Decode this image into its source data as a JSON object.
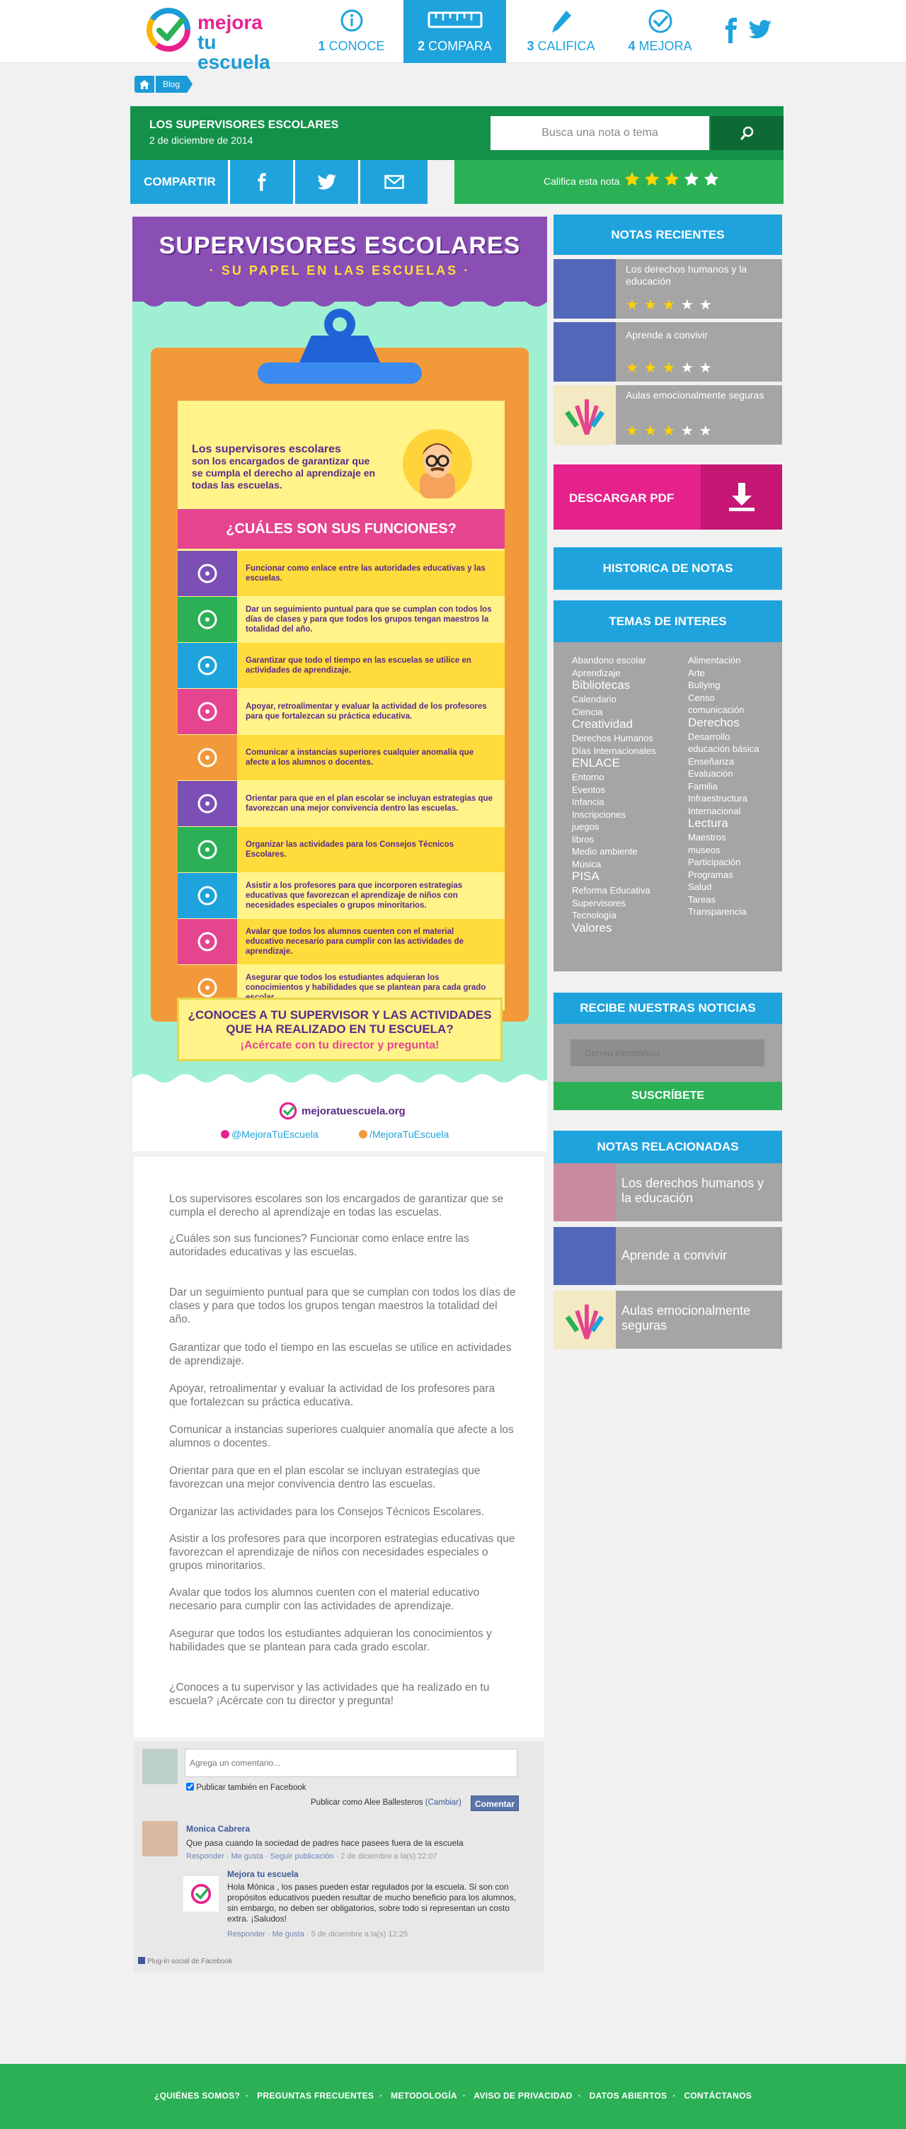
{
  "brand": {
    "line1": "mejora",
    "line2": "tu escuela"
  },
  "nav": [
    {
      "num": "1",
      "label": "CONOCE",
      "icon": "info-icon"
    },
    {
      "num": "2",
      "label": "COMPARA",
      "icon": "ruler-icon"
    },
    {
      "num": "3",
      "label": "CALIFICA",
      "icon": "pencil-icon"
    },
    {
      "num": "4",
      "label": "MEJORA",
      "icon": "check-icon"
    }
  ],
  "breadcrumb": {
    "item": "Blog"
  },
  "post": {
    "title": "LOS SUPERVISORES ESCOLARES",
    "date": "2 de diciembre de 2014"
  },
  "search": {
    "placeholder": "Busca una nota o tema"
  },
  "share": {
    "label": "COMPARTIR",
    "rate_label": "Califica esta nota"
  },
  "infographic": {
    "title": "SUPERVISORES ESCOLARES",
    "subtitle": "· SU PAPEL EN LAS ESCUELAS ·",
    "intro_head": "Los supervisores escolares",
    "intro_body": "son los encargados de garantizar que se cumpla el derecho al aprendizaje en todas las escuelas.",
    "question": "¿CUÁLES SON SUS FUNCIONES?",
    "functions": [
      "Funcionar como enlace entre las autoridades educativas y las escuelas.",
      "Dar un seguimiento puntual para que se cumplan con todos los días de clases y para que todos los grupos tengan maestros la totalidad del año.",
      "Garantizar que todo el tiempo en las escuelas se utilice en actividades de aprendizaje.",
      "Apoyar, retroalimentar y evaluar la actividad de los profesores para que fortalezcan su práctica educativa.",
      "Comunicar a instancias superiores cualquier anomalía que afecte a los alumnos o docentes.",
      "Orientar para que en el plan escolar se incluyan estrategias que favorezcan una mejor convivencia dentro las escuelas.",
      "Organizar las actividades para los Consejos Técnicos Escolares.",
      "Asistir a los profesores para que incorporen estrategias educativas que favorezcan el aprendizaje de niños con necesidades especiales o grupos minoritarios.",
      "Avalar que todos los alumnos cuenten con el material educativo necesario para cumplir con las actividades de aprendizaje.",
      "Asegurar que todos los estudiantes adquieran los conocimientos y habilidades que se plantean para cada grado escolar."
    ],
    "cta_line1": "¿CONOCES A TU SUPERVISOR Y LAS ACTIVIDADES",
    "cta_line2": "QUE HA REALIZADO EN TU ESCUELA?",
    "cta_line3": "¡Acércate con tu director y pregunta!",
    "site": "mejoratuescuela.org",
    "twitter": "@MejoraTuEscuela",
    "facebook": "/MejoraTuEscuela"
  },
  "article": [
    "Los supervisores escolares son los encargados de garantizar que se cumpla el derecho al aprendizaje en todas las escuelas.",
    "¿Cuáles son sus funciones? Funcionar como enlace entre las autoridades educativas y las escuelas.",
    "Dar un seguimiento puntual para que se cumplan con todos los días de clases y para que todos los grupos tengan maestros la totalidad del año.",
    "Garantizar que todo el tiempo en las escuelas se utilice en actividades de aprendizaje.",
    "Apoyar, retroalimentar y evaluar la actividad de los profesores para que fortalezcan su práctica educativa.",
    "Comunicar a instancias superiores cualquier anomalía que afecte a los alumnos o docentes.",
    "Orientar para que en el plan escolar se incluyan estrategias que favorezcan una mejor convivencia dentro las escuelas.",
    "Organizar las actividades para los Consejos Técnicos Escolares.",
    "Asistir a los profesores para que incorporen estrategias educativas que favorezcan el aprendizaje de niños con necesidades especiales o grupos minoritarios.",
    "Avalar que todos los alumnos cuenten con el material educativo necesario para cumplir con las actividades de aprendizaje.",
    "Asegurar que todos los estudiantes adquieran los conocimientos y habilidades que se plantean para cada grado escolar.",
    "¿Conoces a tu supervisor y las actividades que ha realizado en tu escuela? ¡Acércate con tu director y pregunta!"
  ],
  "comments": {
    "placeholder": "Agrega un comentario...",
    "also_post": "Publicar también en Facebook",
    "post_as": "Publicar como Alee Ballesteros",
    "change": "(Cambiar)",
    "submit": "Comentar",
    "items": [
      {
        "name": "Monica Cabrera",
        "text": "Que pasa cuando la sociedad de padres hace pasees fuera de la escuela",
        "actions": "Responder · Me gusta · Seguir publicación",
        "date": "· 2 de diciembre a la(s) 22:07"
      },
      {
        "name": "Mejora tu escuela",
        "text": "Hola Mónica , los pases pueden estar regulados por la escuela. Si son con propósitos educativos pueden resultar de mucho beneficio para los alumnos, sin embargo, no deben ser obligatorios, sobre todo si representan un costo extra. ¡Saludos!",
        "actions": "Responder · Me gusta",
        "date": "· 5 de diciembre a la(s) 12:25"
      }
    ],
    "plugin": "Plug-in social de Facebook"
  },
  "sidebar": {
    "recent_title": "NOTAS RECIENTES",
    "recent": [
      {
        "title": "Los derechos humanos y la educación",
        "rating": 3
      },
      {
        "title": "Aprende  a convivir",
        "rating": 3
      },
      {
        "title": "Aulas emocionalmente seguras",
        "rating": 3
      }
    ],
    "pdf_label": "DESCARGAR PDF",
    "history_label": "HISTORICA DE NOTAS",
    "topics_title": "TEMAS DE INTERES",
    "topics_left": [
      {
        "t": "Abandono escolar",
        "s": 13
      },
      {
        "t": "Aprendizaje",
        "s": 13
      },
      {
        "t": "Bibliotecas",
        "s": 17
      },
      {
        "t": "Calendario",
        "s": 13
      },
      {
        "t": "Ciencia",
        "s": 13
      },
      {
        "t": "Creatividad",
        "s": 17
      },
      {
        "t": "Derechos Humanos",
        "s": 13
      },
      {
        "t": "Días Internacionales",
        "s": 13
      },
      {
        "t": "ENLACE",
        "s": 17
      },
      {
        "t": "Entorno",
        "s": 13
      },
      {
        "t": "Eventos",
        "s": 13
      },
      {
        "t": "Infancia",
        "s": 13
      },
      {
        "t": "Inscripciones",
        "s": 13
      },
      {
        "t": "juegos",
        "s": 13
      },
      {
        "t": "libros",
        "s": 13
      },
      {
        "t": "Medio ambiente",
        "s": 13
      },
      {
        "t": "Música",
        "s": 13
      },
      {
        "t": "PISA",
        "s": 17
      },
      {
        "t": "Reforma Educativa",
        "s": 13
      },
      {
        "t": "Supervisores",
        "s": 13
      },
      {
        "t": "Tecnología",
        "s": 13
      },
      {
        "t": "Valores",
        "s": 17
      }
    ],
    "topics_right": [
      {
        "t": "Alimentación",
        "s": 13
      },
      {
        "t": "Arte",
        "s": 13
      },
      {
        "t": "Bullying",
        "s": 13
      },
      {
        "t": "Censo",
        "s": 13
      },
      {
        "t": "comunicación",
        "s": 13
      },
      {
        "t": "Derechos",
        "s": 17
      },
      {
        "t": "Desarrollo",
        "s": 13
      },
      {
        "t": "educación básica",
        "s": 13
      },
      {
        "t": "Enseñanza",
        "s": 13
      },
      {
        "t": "Evaluación",
        "s": 13
      },
      {
        "t": "Familia",
        "s": 13
      },
      {
        "t": "Infraestructura",
        "s": 13
      },
      {
        "t": "Internacional",
        "s": 13
      },
      {
        "t": "Lectura",
        "s": 17
      },
      {
        "t": "Maestros",
        "s": 13
      },
      {
        "t": "museos",
        "s": 13
      },
      {
        "t": "Participación",
        "s": 13
      },
      {
        "t": "Programas",
        "s": 13
      },
      {
        "t": "Salud",
        "s": 13
      },
      {
        "t": "Tareas",
        "s": 13
      },
      {
        "t": "Transparencia",
        "s": 13
      }
    ],
    "news_title": "RECIBE NUESTRAS NOTICIAS",
    "email_placeholder": "Correo electrónico",
    "subscribe": "SUSCRÍBETE",
    "related_title": "NOTAS RELACIONADAS",
    "related": [
      "Los derechos humanos y la educación",
      "Aprende  a convivir",
      "Aulas emocionalmente seguras"
    ]
  },
  "footer": [
    "¿QUIÉNES SOMOS?",
    "PREGUNTAS FRECUENTES",
    "METODOLOGÍA",
    "AVISO DE PRIVACIDAD",
    "DATOS ABIERTOS",
    "CONTÁCTANOS"
  ],
  "colors": {
    "brand_blue": "#1ea3dd",
    "brand_green": "#2bb056",
    "dark_green": "#13914a",
    "pink": "#e5218b",
    "sidebar_grey": "#a5a5a5",
    "star_yellow": "#ffd400",
    "star_white": "#ffffff"
  }
}
